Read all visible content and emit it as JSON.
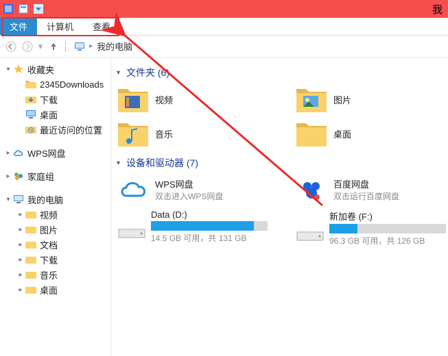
{
  "titlebar": {
    "window_title_partial": "我"
  },
  "tabs": {
    "file": "文件",
    "computer": "计算机",
    "view": "查看"
  },
  "breadcrumb": {
    "location": "我的电脑"
  },
  "sidebar": {
    "favorites": {
      "label": "收藏夹",
      "items": [
        {
          "label": "2345Downloads"
        },
        {
          "label": "下载"
        },
        {
          "label": "桌面"
        },
        {
          "label": "最近访问的位置"
        }
      ]
    },
    "wps": {
      "label": "WPS网盘"
    },
    "homegroup": {
      "label": "家庭组"
    },
    "thispc": {
      "label": "我的电脑",
      "items": [
        {
          "label": "视频"
        },
        {
          "label": "图片"
        },
        {
          "label": "文档"
        },
        {
          "label": "下载"
        },
        {
          "label": "音乐"
        },
        {
          "label": "桌面"
        }
      ]
    }
  },
  "content": {
    "folders_header": "文件夹 (6)",
    "devices_header": "设备和驱动器 (7)",
    "folders": [
      {
        "name": "视频"
      },
      {
        "name": "图片"
      },
      {
        "name": "音乐"
      },
      {
        "name": "桌面"
      }
    ],
    "cloud": [
      {
        "name": "WPS网盘",
        "sub": "双击进入WPS网盘"
      },
      {
        "name": "百度网盘",
        "sub": "双击运行百度网盘"
      }
    ],
    "drives": [
      {
        "name": "Data (D:)",
        "caption": "14.5 GB 可用，共 131 GB",
        "fill_pct": 88
      },
      {
        "name": "新加卷 (F:)",
        "caption": "96.3 GB 可用，共 126 GB",
        "fill_pct": 24
      }
    ]
  }
}
